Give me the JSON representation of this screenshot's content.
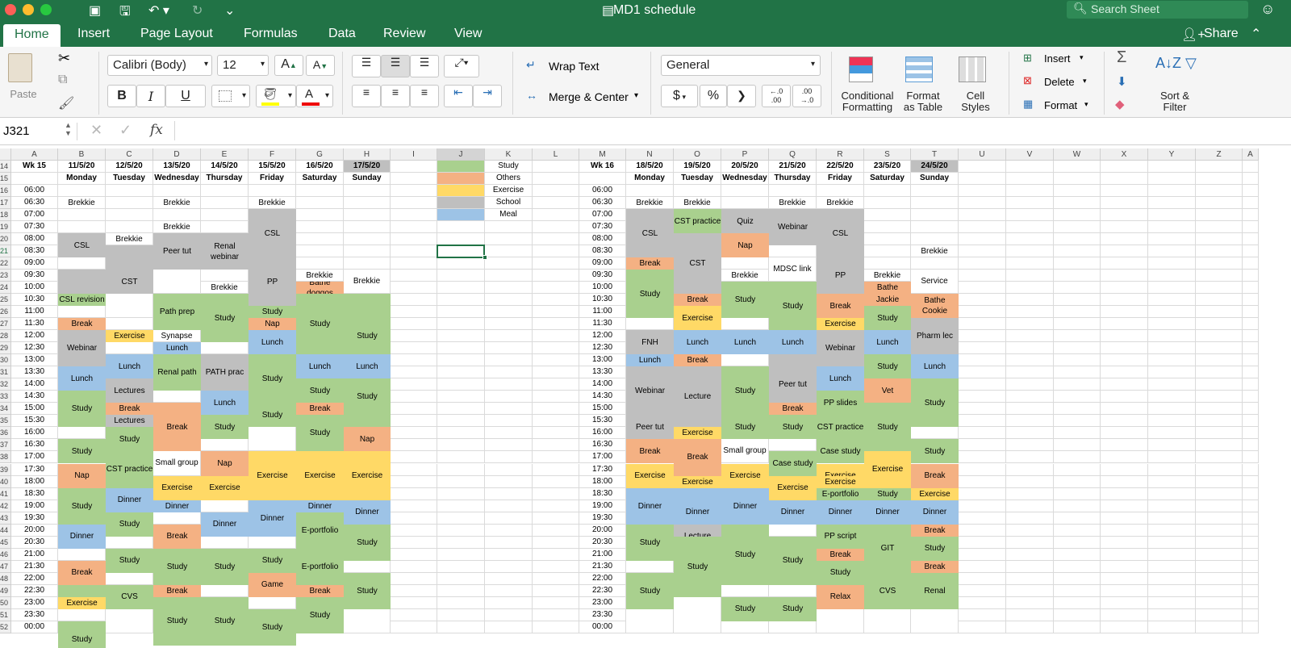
{
  "app": {
    "title": "MD1 schedule",
    "search_placeholder": "Search Sheet"
  },
  "ribbon": {
    "tabs": [
      "Home",
      "Insert",
      "Page Layout",
      "Formulas",
      "Data",
      "Review",
      "View"
    ],
    "share": "Share"
  },
  "toolbar": {
    "paste": "Paste",
    "font_name": "Calibri (Body)",
    "font_size": "12",
    "bold": "B",
    "italic": "I",
    "underline": "U",
    "wrap_text": "Wrap Text",
    "merge_center": "Merge & Center",
    "number_format": "General",
    "currency": "$",
    "percent": "%",
    "comma": "❯",
    "inc_decimal": ".0\n.00",
    "dec_decimal": ".00\n.0",
    "conditional_formatting": "Conditional\nFormatting",
    "format_as_table": "Format\nas Table",
    "cell_styles": "Cell\nStyles",
    "insert": "Insert",
    "delete": "Delete",
    "format": "Format",
    "sort_filter": "Sort &\nFilter"
  },
  "formula_bar": {
    "name_box": "J321",
    "fx": "fx",
    "value": ""
  },
  "colors": {
    "green": "#a9d08e",
    "orange": "#f4b183",
    "yellow": "#ffd966",
    "gray": "#bfbfbf",
    "blue": "#9dc3e6",
    "header_gray": "#bfbfbf"
  },
  "columns": [
    "A",
    "B",
    "C",
    "D",
    "E",
    "F",
    "G",
    "H",
    "I",
    "J",
    "K",
    "L",
    "M",
    "N",
    "O",
    "P",
    "Q",
    "R",
    "S",
    "T",
    "U",
    "V",
    "W",
    "X",
    "Y",
    "Z",
    "A"
  ],
  "rows": [
    "14",
    "15",
    "16",
    "17",
    "18",
    "19",
    "20",
    "21",
    "22",
    "23",
    "24",
    "25",
    "26",
    "27",
    "28",
    "29",
    "30",
    "31",
    "32",
    "33",
    "34",
    "35",
    "36",
    "37",
    "38",
    "39",
    "40",
    "41",
    "42",
    "43",
    "44",
    "45",
    "46",
    "47",
    "48",
    "49",
    "50",
    "51",
    "52"
  ],
  "times": [
    "06:00",
    "06:30",
    "07:00",
    "07:30",
    "08:00",
    "08:30",
    "09:00",
    "09:30",
    "10:00",
    "10:30",
    "11:00",
    "11:30",
    "12:00",
    "12:30",
    "13:00",
    "13:30",
    "14:00",
    "14:30",
    "15:00",
    "15:30",
    "16:00",
    "16:30",
    "17:00",
    "17:30",
    "18:00",
    "18:30",
    "19:00",
    "19:30",
    "20:00",
    "20:30",
    "21:00",
    "21:30",
    "22:00",
    "22:30",
    "23:00",
    "23:30",
    "00:00"
  ],
  "week1": {
    "label": "Wk 15",
    "dates": [
      "11/5/20",
      "12/5/20",
      "13/5/20",
      "14/5/20",
      "15/5/20",
      "16/5/20",
      "17/5/20"
    ],
    "days": [
      "Monday",
      "Tuesday",
      "Wednesday",
      "Thursday",
      "Friday",
      "Saturday",
      "Sunday"
    ]
  },
  "week2": {
    "label": "Wk 16",
    "dates": [
      "18/5/20",
      "19/5/20",
      "20/5/20",
      "21/5/20",
      "22/5/20",
      "23/5/20",
      "24/5/20"
    ],
    "days": [
      "Monday",
      "Tuesday",
      "Wednesday",
      "Thursday",
      "Friday",
      "Saturday",
      "Sunday"
    ]
  },
  "legend": [
    {
      "label": "Study",
      "color": "green"
    },
    {
      "label": "Others",
      "color": "orange"
    },
    {
      "label": "Exercise",
      "color": "yellow"
    },
    {
      "label": "School",
      "color": "gray"
    },
    {
      "label": "Meal",
      "color": "blue"
    }
  ],
  "blocks1": [
    [
      0,
      1,
      1,
      "w",
      "Brekkie"
    ],
    [
      0,
      4,
      5,
      "gray",
      "CSL"
    ],
    [
      0,
      6,
      6,
      "w",
      ""
    ],
    [
      0,
      7,
      8,
      "gray",
      ""
    ],
    [
      0,
      9,
      9,
      "green",
      "CSL revision"
    ],
    [
      0,
      10,
      10,
      "w",
      ""
    ],
    [
      0,
      11,
      11,
      "orange",
      "Break"
    ],
    [
      0,
      12,
      14,
      "gray",
      "Webinar"
    ],
    [
      0,
      15,
      16,
      "blue",
      "Lunch"
    ],
    [
      0,
      17,
      19,
      "green",
      "Study"
    ],
    [
      0,
      20,
      20,
      "w",
      ""
    ],
    [
      0,
      21,
      22,
      "green",
      "Study"
    ],
    [
      0,
      23,
      24,
      "orange",
      "Nap"
    ],
    [
      0,
      25,
      27,
      "green",
      "Study"
    ],
    [
      0,
      28,
      29,
      "blue",
      "Dinner"
    ],
    [
      0,
      30,
      30,
      "w",
      ""
    ],
    [
      0,
      31,
      32,
      "orange",
      "Break"
    ],
    [
      0,
      33,
      33,
      "green",
      ""
    ],
    [
      0,
      34,
      34,
      "yellow",
      "Exercise"
    ],
    [
      0,
      35,
      35,
      "w",
      ""
    ],
    [
      0,
      36,
      38,
      "green",
      "Study"
    ],
    [
      1,
      4,
      4,
      "w",
      "Brekkie"
    ],
    [
      1,
      5,
      6,
      "gray",
      ""
    ],
    [
      1,
      7,
      8,
      "gray",
      "CST"
    ],
    [
      1,
      9,
      10,
      "w",
      ""
    ],
    [
      1,
      11,
      11,
      "w",
      ""
    ],
    [
      1,
      12,
      12,
      "yellow",
      "Exercise"
    ],
    [
      1,
      13,
      13,
      "w",
      ""
    ],
    [
      1,
      14,
      15,
      "blue",
      "Lunch"
    ],
    [
      1,
      16,
      17,
      "gray",
      "Lectures"
    ],
    [
      1,
      18,
      18,
      "orange",
      "Break"
    ],
    [
      1,
      19,
      19,
      "gray",
      "Lectures"
    ],
    [
      1,
      20,
      21,
      "green",
      "Study"
    ],
    [
      1,
      22,
      24,
      "green",
      "CST practice"
    ],
    [
      1,
      25,
      26,
      "blue",
      "Dinner"
    ],
    [
      1,
      27,
      28,
      "green",
      "Study"
    ],
    [
      1,
      29,
      29,
      "w",
      ""
    ],
    [
      1,
      30,
      31,
      "green",
      "Study"
    ],
    [
      1,
      32,
      32,
      "w",
      ""
    ],
    [
      1,
      33,
      34,
      "green",
      "CVS"
    ],
    [
      1,
      35,
      36,
      "w",
      ""
    ],
    [
      2,
      1,
      1,
      "w",
      "Brekkie"
    ],
    [
      2,
      2,
      2,
      "w",
      ""
    ],
    [
      2,
      3,
      3,
      "w",
      "Brekkie"
    ],
    [
      2,
      4,
      6,
      "gray",
      "Peer tut"
    ],
    [
      2,
      7,
      8,
      "w",
      ""
    ],
    [
      2,
      9,
      11,
      "green",
      "Path prep"
    ],
    [
      2,
      12,
      12,
      "w",
      "Synapse"
    ],
    [
      2,
      13,
      13,
      "blue",
      "Lunch"
    ],
    [
      2,
      14,
      16,
      "green",
      "Renal path"
    ],
    [
      2,
      17,
      17,
      "w",
      ""
    ],
    [
      2,
      18,
      21,
      "orange",
      "Break"
    ],
    [
      2,
      22,
      23,
      "w",
      "Small group"
    ],
    [
      2,
      24,
      25,
      "yellow",
      "Exercise"
    ],
    [
      2,
      26,
      26,
      "blue",
      "Dinner"
    ],
    [
      2,
      27,
      27,
      "w",
      ""
    ],
    [
      2,
      28,
      29,
      "orange",
      "Break"
    ],
    [
      2,
      30,
      32,
      "green",
      "Study"
    ],
    [
      2,
      33,
      33,
      "orange",
      "Break"
    ],
    [
      2,
      34,
      37,
      "green",
      "Study"
    ],
    [
      3,
      3,
      3,
      "w",
      ""
    ],
    [
      3,
      4,
      6,
      "gray",
      "Renal webinar"
    ],
    [
      3,
      7,
      7,
      "w",
      ""
    ],
    [
      3,
      8,
      8,
      "w",
      "Brekkie"
    ],
    [
      3,
      9,
      12,
      "green",
      "Study"
    ],
    [
      3,
      13,
      13,
      "w",
      ""
    ],
    [
      3,
      14,
      16,
      "gray",
      "PATH prac"
    ],
    [
      3,
      17,
      18,
      "blue",
      "Lunch"
    ],
    [
      3,
      19,
      20,
      "green",
      "Study"
    ],
    [
      3,
      21,
      21,
      "w",
      ""
    ],
    [
      3,
      22,
      23,
      "orange",
      "Nap"
    ],
    [
      3,
      24,
      25,
      "yellow",
      "Exercise"
    ],
    [
      3,
      26,
      26,
      "w",
      ""
    ],
    [
      3,
      27,
      28,
      "blue",
      "Dinner"
    ],
    [
      3,
      29,
      29,
      "w",
      ""
    ],
    [
      3,
      30,
      32,
      "green",
      "Study"
    ],
    [
      3,
      33,
      33,
      "w",
      ""
    ],
    [
      3,
      34,
      37,
      "green",
      "Study"
    ],
    [
      4,
      1,
      1,
      "w",
      "Brekkie"
    ],
    [
      4,
      2,
      5,
      "gray",
      "CSL"
    ],
    [
      4,
      6,
      9,
      "gray",
      "PP"
    ],
    [
      4,
      10,
      10,
      "green",
      "Study"
    ],
    [
      4,
      11,
      11,
      "orange",
      "Nap"
    ],
    [
      4,
      12,
      13,
      "blue",
      "Lunch"
    ],
    [
      4,
      14,
      17,
      "green",
      "Study"
    ],
    [
      4,
      18,
      19,
      "green",
      "Study"
    ],
    [
      4,
      20,
      21,
      "w",
      ""
    ],
    [
      4,
      22,
      25,
      "yellow",
      "Exercise"
    ],
    [
      4,
      26,
      28,
      "blue",
      "Dinner"
    ],
    [
      4,
      29,
      29,
      "w",
      ""
    ],
    [
      4,
      30,
      31,
      "green",
      "Study"
    ],
    [
      4,
      32,
      33,
      "orange",
      "Game"
    ],
    [
      4,
      34,
      34,
      "w",
      ""
    ],
    [
      4,
      35,
      37,
      "green",
      "Study"
    ],
    [
      5,
      7,
      7,
      "w",
      "Brekkie"
    ],
    [
      5,
      8,
      8,
      "orange",
      "Bathe doggos"
    ],
    [
      5,
      9,
      13,
      "green",
      "Study"
    ],
    [
      5,
      14,
      15,
      "blue",
      "Lunch"
    ],
    [
      5,
      16,
      17,
      "green",
      "Study"
    ],
    [
      5,
      18,
      18,
      "orange",
      "Break"
    ],
    [
      5,
      19,
      21,
      "green",
      "Study"
    ],
    [
      5,
      22,
      25,
      "yellow",
      "Exercise"
    ],
    [
      5,
      26,
      26,
      "blue",
      "Dinner"
    ],
    [
      5,
      27,
      29,
      "green",
      "E-portfolio"
    ],
    [
      5,
      30,
      32,
      "green",
      "E-portfolio"
    ],
    [
      5,
      33,
      33,
      "orange",
      "Break"
    ],
    [
      5,
      34,
      36,
      "green",
      "Study"
    ],
    [
      6,
      7,
      8,
      "w",
      "Brekkie"
    ],
    [
      6,
      9,
      15,
      "green",
      "Study"
    ],
    [
      6,
      14,
      15,
      "blue",
      "Lunch"
    ],
    [
      6,
      16,
      18,
      "green",
      "Study"
    ],
    [
      6,
      19,
      19,
      "green",
      ""
    ],
    [
      6,
      20,
      21,
      "orange",
      "Nap"
    ],
    [
      6,
      22,
      25,
      "yellow",
      "Exercise"
    ],
    [
      6,
      26,
      27,
      "blue",
      "Dinner"
    ],
    [
      6,
      28,
      30,
      "green",
      "Study"
    ],
    [
      6,
      31,
      31,
      "w",
      ""
    ],
    [
      6,
      32,
      34,
      "green",
      "Study"
    ],
    [
      6,
      35,
      36,
      "w",
      ""
    ]
  ],
  "blocks2": [
    [
      0,
      1,
      1,
      "w",
      "Brekkie"
    ],
    [
      0,
      2,
      5,
      "gray",
      "CSL"
    ],
    [
      0,
      6,
      6,
      "orange",
      "Break"
    ],
    [
      0,
      7,
      10,
      "green",
      "Study"
    ],
    [
      0,
      11,
      11,
      "w",
      ""
    ],
    [
      0,
      12,
      13,
      "gray",
      "FNH"
    ],
    [
      0,
      14,
      14,
      "blue",
      "Lunch"
    ],
    [
      0,
      15,
      18,
      "gray",
      "Webinar"
    ],
    [
      0,
      19,
      20,
      "gray",
      "Peer tut"
    ],
    [
      0,
      21,
      22,
      "orange",
      "Break"
    ],
    [
      0,
      23,
      24,
      "yellow",
      "Exercise"
    ],
    [
      0,
      25,
      27,
      "blue",
      "Dinner"
    ],
    [
      0,
      28,
      30,
      "green",
      "Study"
    ],
    [
      0,
      31,
      31,
      "w",
      ""
    ],
    [
      0,
      32,
      34,
      "green",
      "Study"
    ],
    [
      0,
      35,
      36,
      "w",
      ""
    ],
    [
      1,
      1,
      1,
      "w",
      "Brekkie"
    ],
    [
      1,
      2,
      3,
      "green",
      "CST practice"
    ],
    [
      1,
      4,
      8,
      "gray",
      "CST"
    ],
    [
      1,
      9,
      9,
      "orange",
      "Break"
    ],
    [
      1,
      10,
      11,
      "yellow",
      "Exercise"
    ],
    [
      1,
      12,
      13,
      "blue",
      "Lunch"
    ],
    [
      1,
      14,
      14,
      "orange",
      "Break"
    ],
    [
      1,
      15,
      19,
      "gray",
      "Lecture"
    ],
    [
      1,
      20,
      20,
      "yellow",
      "Exercise"
    ],
    [
      1,
      21,
      23,
      "orange",
      "Break"
    ],
    [
      1,
      24,
      24,
      "yellow",
      "Exercise"
    ],
    [
      1,
      25,
      28,
      "blue",
      "Dinner"
    ],
    [
      1,
      28,
      29,
      "gray",
      "Lecture"
    ],
    [
      1,
      29,
      33,
      "green",
      "Study"
    ],
    [
      1,
      34,
      36,
      "w",
      ""
    ],
    [
      2,
      2,
      3,
      "gray",
      "Quiz"
    ],
    [
      2,
      4,
      5,
      "orange",
      "Nap"
    ],
    [
      2,
      6,
      6,
      "w",
      ""
    ],
    [
      2,
      7,
      7,
      "w",
      "Brekkie"
    ],
    [
      2,
      8,
      10,
      "green",
      "Study"
    ],
    [
      2,
      12,
      13,
      "blue",
      "Lunch"
    ],
    [
      2,
      14,
      14,
      "w",
      ""
    ],
    [
      2,
      15,
      18,
      "green",
      "Study"
    ],
    [
      2,
      19,
      20,
      "green",
      "Study"
    ],
    [
      2,
      21,
      22,
      "w",
      "Small group"
    ],
    [
      2,
      23,
      24,
      "yellow",
      "Exercise"
    ],
    [
      2,
      25,
      27,
      "blue",
      "Dinner"
    ],
    [
      2,
      28,
      32,
      "green",
      "Study"
    ],
    [
      2,
      33,
      33,
      "w",
      ""
    ],
    [
      2,
      34,
      35,
      "green",
      "Study"
    ],
    [
      3,
      1,
      1,
      "w",
      "Brekkie"
    ],
    [
      3,
      2,
      4,
      "gray",
      "Webinar"
    ],
    [
      3,
      5,
      5,
      "w",
      ""
    ],
    [
      3,
      6,
      7,
      "w",
      "MDSC link"
    ],
    [
      3,
      8,
      11,
      "green",
      "Study"
    ],
    [
      3,
      12,
      13,
      "blue",
      "Lunch"
    ],
    [
      3,
      14,
      18,
      "gray",
      "Peer tut"
    ],
    [
      3,
      18,
      18,
      "orange",
      "Break"
    ],
    [
      3,
      19,
      20,
      "green",
      "Study"
    ],
    [
      3,
      21,
      21,
      "w",
      ""
    ],
    [
      3,
      22,
      23,
      "green",
      "Case study"
    ],
    [
      3,
      24,
      25,
      "yellow",
      "Exercise"
    ],
    [
      3,
      26,
      27,
      "blue",
      "Dinner"
    ],
    [
      3,
      28,
      28,
      "w",
      ""
    ],
    [
      3,
      29,
      32,
      "green",
      "Study"
    ],
    [
      3,
      33,
      33,
      "w",
      ""
    ],
    [
      3,
      34,
      35,
      "green",
      "Study"
    ],
    [
      4,
      1,
      1,
      "w",
      "Brekkie"
    ],
    [
      4,
      2,
      5,
      "gray",
      "CSL"
    ],
    [
      4,
      6,
      8,
      "gray",
      "PP"
    ],
    [
      4,
      9,
      10,
      "orange",
      "Break"
    ],
    [
      4,
      11,
      11,
      "yellow",
      "Exercise"
    ],
    [
      4,
      12,
      14,
      "gray",
      "Webinar"
    ],
    [
      4,
      15,
      16,
      "blue",
      "Lunch"
    ],
    [
      4,
      17,
      18,
      "green",
      "PP slides"
    ],
    [
      4,
      19,
      20,
      "green",
      "CST practice"
    ],
    [
      4,
      21,
      22,
      "green",
      "Case study"
    ],
    [
      4,
      23,
      24,
      "yellow",
      "Exercise"
    ],
    [
      4,
      24,
      24,
      "yellow",
      "Exercise"
    ],
    [
      4,
      25,
      25,
      "green",
      "E-portfolio"
    ],
    [
      4,
      26,
      27,
      "blue",
      "Dinner"
    ],
    [
      4,
      28,
      29,
      "green",
      "PP script"
    ],
    [
      4,
      30,
      30,
      "orange",
      "Break"
    ],
    [
      4,
      31,
      32,
      "green",
      "Study"
    ],
    [
      4,
      33,
      34,
      "orange",
      "Relax"
    ],
    [
      4,
      35,
      36,
      "w",
      ""
    ],
    [
      5,
      7,
      7,
      "w",
      "Brekkie"
    ],
    [
      5,
      8,
      8,
      "orange",
      "Bathe"
    ],
    [
      5,
      9,
      9,
      "orange",
      "Jackie"
    ],
    [
      5,
      10,
      11,
      "green",
      "Study"
    ],
    [
      5,
      12,
      13,
      "blue",
      "Lunch"
    ],
    [
      5,
      14,
      15,
      "green",
      "Study"
    ],
    [
      5,
      16,
      17,
      "orange",
      "Vet"
    ],
    [
      5,
      18,
      21,
      "green",
      "Study"
    ],
    [
      5,
      22,
      24,
      "yellow",
      "Exercise"
    ],
    [
      5,
      25,
      25,
      "green",
      "Study"
    ],
    [
      5,
      26,
      27,
      "blue",
      "Dinner"
    ],
    [
      5,
      28,
      31,
      "green",
      "GIT"
    ],
    [
      5,
      32,
      34,
      "green",
      "CVS"
    ],
    [
      5,
      35,
      36,
      "w",
      ""
    ],
    [
      6,
      5,
      5,
      "w",
      "Brekkie"
    ],
    [
      6,
      6,
      6,
      "w",
      ""
    ],
    [
      6,
      7,
      8,
      "w",
      "Service"
    ],
    [
      6,
      9,
      10,
      "orange",
      "Bathe\nCookie"
    ],
    [
      6,
      11,
      13,
      "gray",
      "Pharm lec"
    ],
    [
      6,
      14,
      15,
      "blue",
      "Lunch"
    ],
    [
      6,
      16,
      19,
      "green",
      "Study"
    ],
    [
      6,
      20,
      20,
      "w",
      ""
    ],
    [
      6,
      21,
      22,
      "green",
      "Study"
    ],
    [
      6,
      23,
      24,
      "orange",
      "Break"
    ],
    [
      6,
      25,
      25,
      "yellow",
      "Exercise"
    ],
    [
      6,
      26,
      27,
      "blue",
      "Dinner"
    ],
    [
      6,
      28,
      28,
      "orange",
      "Break"
    ],
    [
      6,
      29,
      30,
      "green",
      "Study"
    ],
    [
      6,
      31,
      31,
      "orange",
      "Break"
    ],
    [
      6,
      32,
      34,
      "green",
      "Renal"
    ],
    [
      6,
      35,
      36,
      "w",
      ""
    ]
  ]
}
